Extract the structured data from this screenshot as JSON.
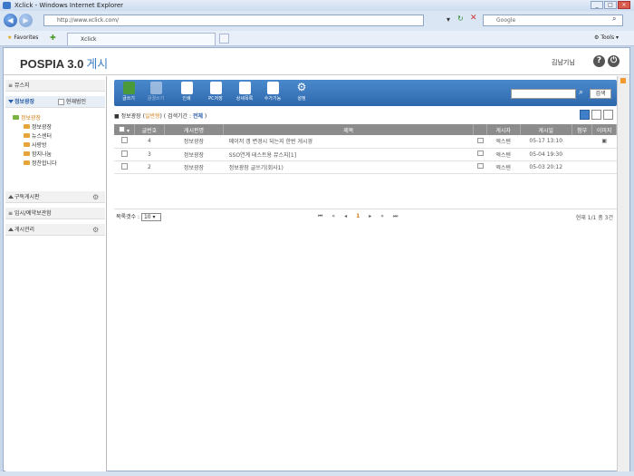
{
  "browser": {
    "title": "Xclick - Windows Internet Explorer",
    "url": "http://www.xclick.com/",
    "search_placeholder": "Google",
    "favorites_label": "Favorites",
    "tab_label": "Xclick",
    "tools_label": "Tools"
  },
  "app": {
    "logo": "POSPIA 3.0",
    "logo_sub": "게시",
    "user_name": "김남기님"
  },
  "sidebar": {
    "sections": [
      {
        "label": "뮤스지"
      },
      {
        "label": "정보광장",
        "extra": "현재범인"
      },
      {
        "label": "구독게시판"
      },
      {
        "label": "임시/예약보관함"
      },
      {
        "label": "게시관리"
      }
    ],
    "tree_root": "정보광장",
    "tree_items": [
      "정보광장",
      "뉴스센터",
      "사랑방",
      "함지나눔",
      "정찬합니다"
    ]
  },
  "toolbar": {
    "buttons": [
      "글쓰기",
      "글결쓰기",
      "인쇄",
      "PC저장",
      "상세목록",
      "수가기능",
      "설정"
    ],
    "search_button": "검색"
  },
  "breadcrumb": {
    "board": "정보광장",
    "mode": "일반형",
    "period_label": "검색기간",
    "period_value": "전체"
  },
  "table": {
    "headers": [
      "",
      "글번호",
      "게시판명",
      "제목",
      "",
      "게시자",
      "게시일",
      "첨부",
      "이미지"
    ],
    "rows": [
      {
        "num": "4",
        "board": "정보광장",
        "title": "메이저 갱 변경시 되는지 한번 게시경",
        "author": "엑스텐",
        "date": "05-17 13:10",
        "attach": "",
        "image": "▣"
      },
      {
        "num": "3",
        "board": "정보광장",
        "title": "SSO연계 테스트용 뮤스지[1]",
        "author": "엑스텐",
        "date": "05-04 19:30",
        "attach": "",
        "image": ""
      },
      {
        "num": "2",
        "board": "정보광장",
        "title": "정보광장 글쓰기(회사1)",
        "author": "엑스텐",
        "date": "05-03 20:12",
        "attach": "",
        "image": ""
      }
    ]
  },
  "pager": {
    "rows_label": "목록갯수",
    "rows_value": "10",
    "current_page": "1",
    "total": "현재 1/1 총 3건"
  }
}
